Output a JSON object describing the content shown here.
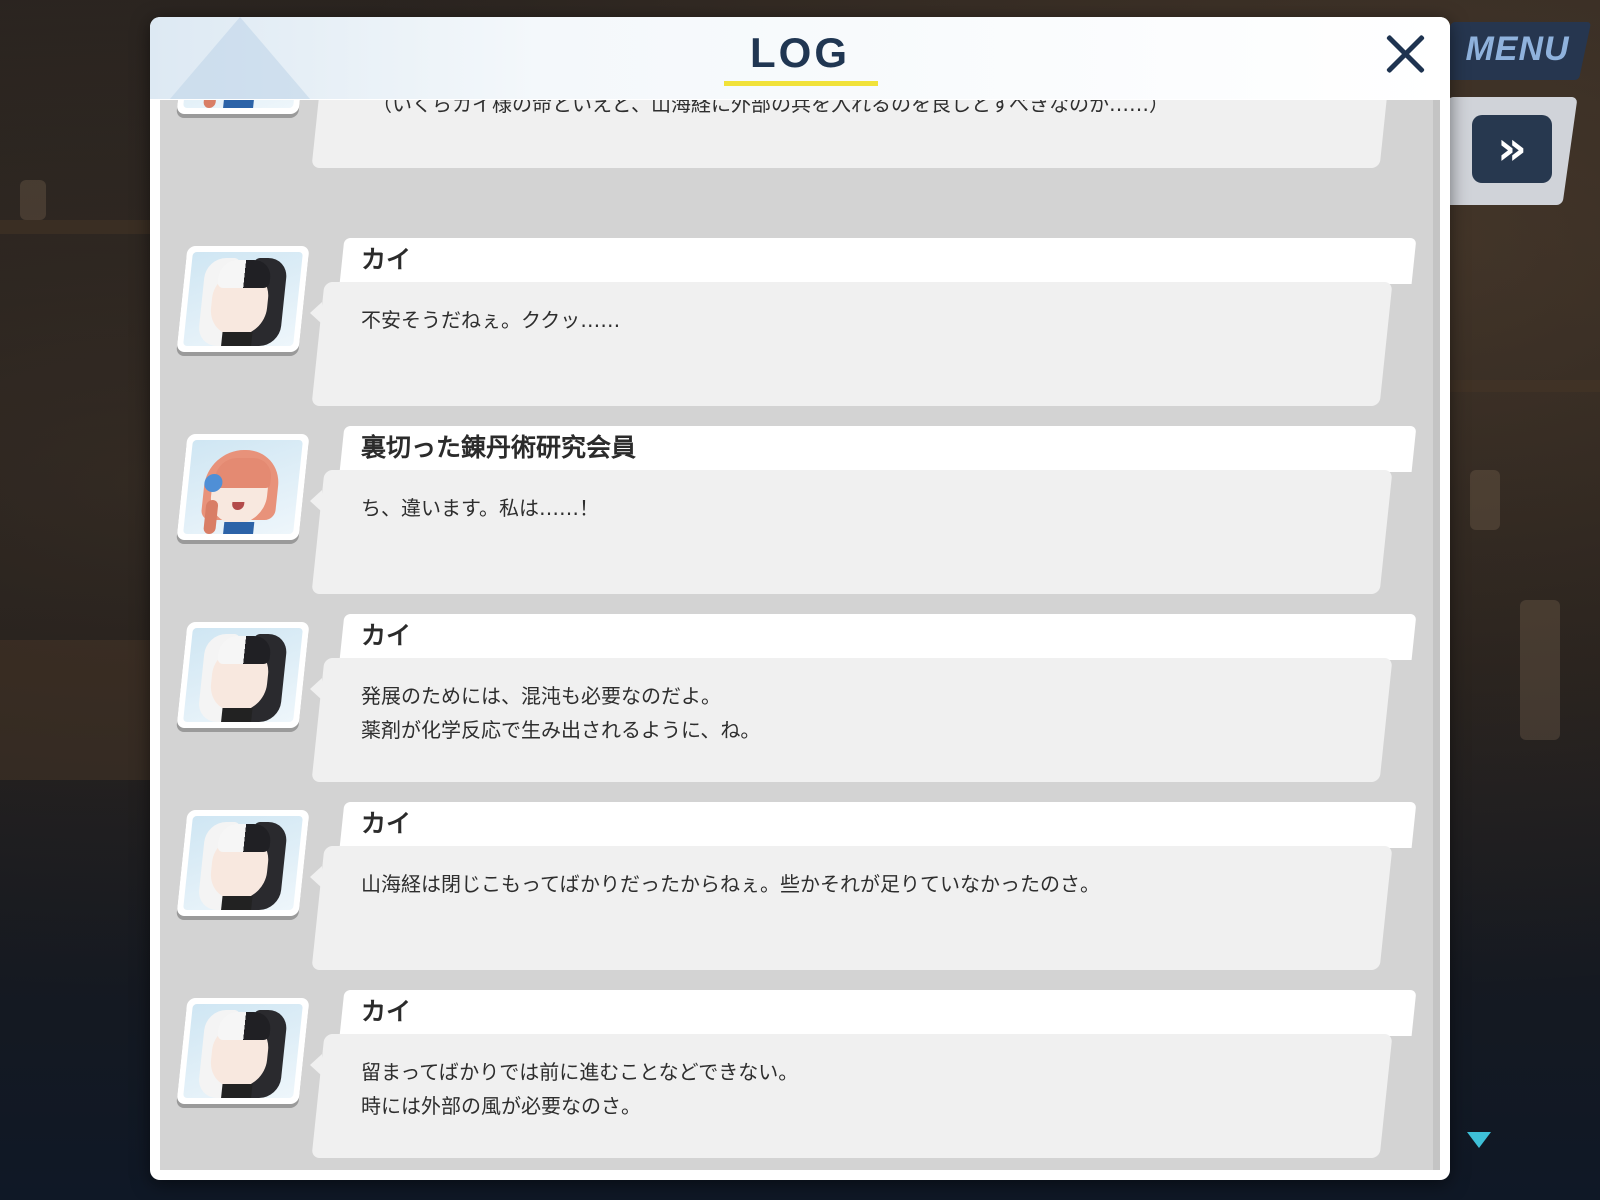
{
  "log": {
    "title": "LOG",
    "close_icon": "close-icon"
  },
  "hud": {
    "menu_label": "MENU",
    "fast_forward_glyph": "»",
    "fast_forward_icon": "fast-forward-icon",
    "scroll_indicator_icon": "triangle-down-icon"
  },
  "colors": {
    "title_accent": "#f1e23a",
    "title_text": "#203652",
    "menu_bg": "#26364f",
    "scroll_indicator": "#3ec0d8"
  },
  "entries": [
    {
      "speaker": "",
      "avatar": "traitor-member",
      "lines": [
        "（いくらカイ様の命といえど、山海経に外部の兵を入れるのを良しとすべきなのか……）",
        ""
      ]
    },
    {
      "speaker": "カイ",
      "avatar": "kai",
      "lines": [
        "不安そうだねぇ。ククッ……",
        ""
      ]
    },
    {
      "speaker": "裏切った錬丹術研究会員",
      "avatar": "traitor-member",
      "lines": [
        "ち、違います。私は……！",
        ""
      ]
    },
    {
      "speaker": "カイ",
      "avatar": "kai",
      "lines": [
        "発展のためには、混沌も必要なのだよ。",
        "薬剤が化学反応で生み出されるように、ね。"
      ]
    },
    {
      "speaker": "カイ",
      "avatar": "kai",
      "lines": [
        "山海経は閉じこもってばかりだったからねぇ。些かそれが足りていなかったのさ。",
        ""
      ]
    },
    {
      "speaker": "カイ",
      "avatar": "kai",
      "lines": [
        "留まってばかりでは前に進むことなどできない。",
        "時には外部の風が必要なのさ。"
      ]
    }
  ]
}
